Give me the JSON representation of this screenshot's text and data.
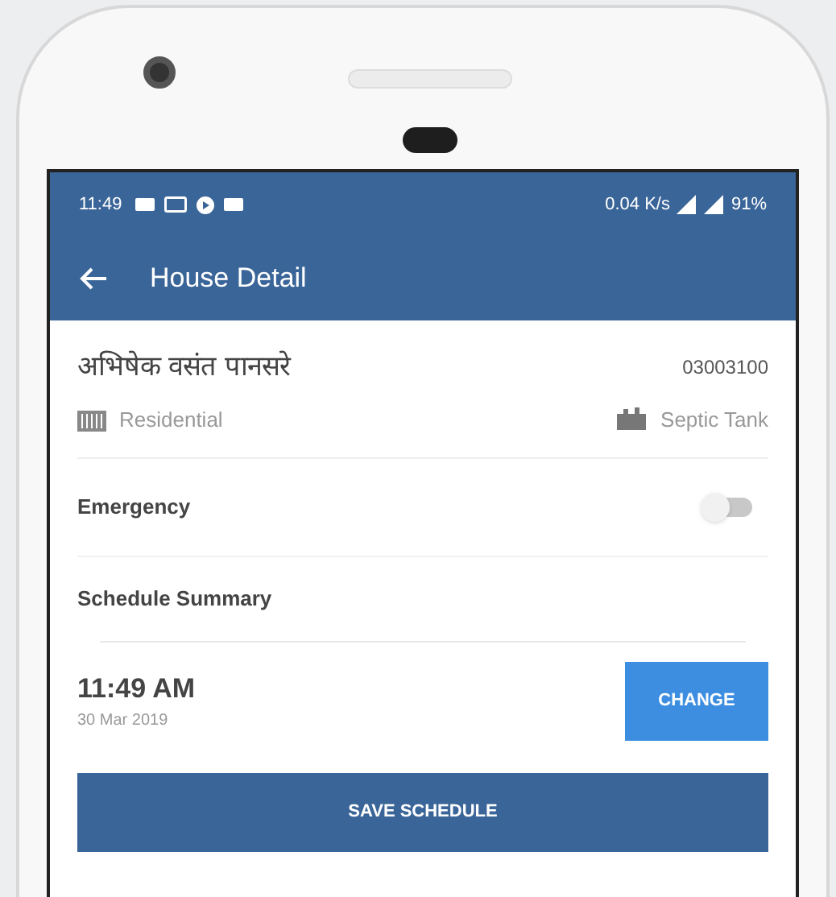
{
  "status_bar": {
    "time": "11:49",
    "speed": "0.04 K/s",
    "battery": "91%"
  },
  "app_bar": {
    "title": "House Detail"
  },
  "house": {
    "owner": "अभिषेक वसंत पानसरे",
    "number": "03003100",
    "type": "Residential",
    "sanitation": "Septic Tank"
  },
  "emergency": {
    "label": "Emergency",
    "on": false
  },
  "schedule": {
    "heading": "Schedule Summary",
    "time": "11:49 AM",
    "date": "30 Mar 2019",
    "change_button": "CHANGE"
  },
  "save_button": "SAVE SCHEDULE"
}
